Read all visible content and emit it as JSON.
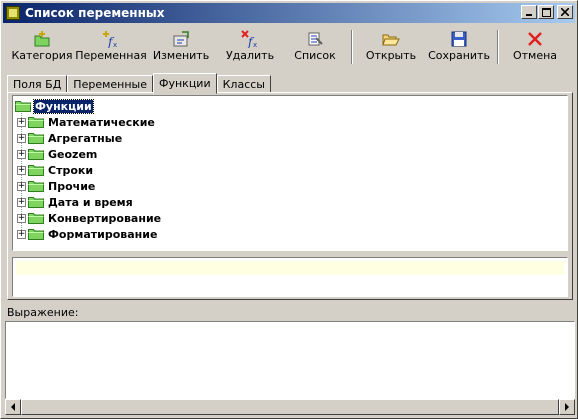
{
  "window": {
    "title": "Список переменных"
  },
  "toolbar": {
    "category": "Категория",
    "variable": "Переменная",
    "edit": "Изменить",
    "delete": "Удалить",
    "list": "Список",
    "open": "Открыть",
    "save": "Сохранить",
    "cancel": "Отмена"
  },
  "tabs": [
    "Поля БД",
    "Переменные",
    "Функции",
    "Классы"
  ],
  "active_tab": "Функции",
  "tree": {
    "root": "Функции",
    "items": [
      "Математические",
      "Агрегатные",
      "Geozem",
      "Строки",
      "Прочие",
      "Дата и время",
      "Конвертирование",
      "Форматирование"
    ]
  },
  "expression": {
    "label": "Выражение:",
    "value": ""
  },
  "colors": {
    "titlebar_start": "#0a246a",
    "titlebar_end": "#a6caf0",
    "folder": "#7fd35f",
    "cancel_icon": "#e02020",
    "info_bg": "#ffffe1"
  }
}
